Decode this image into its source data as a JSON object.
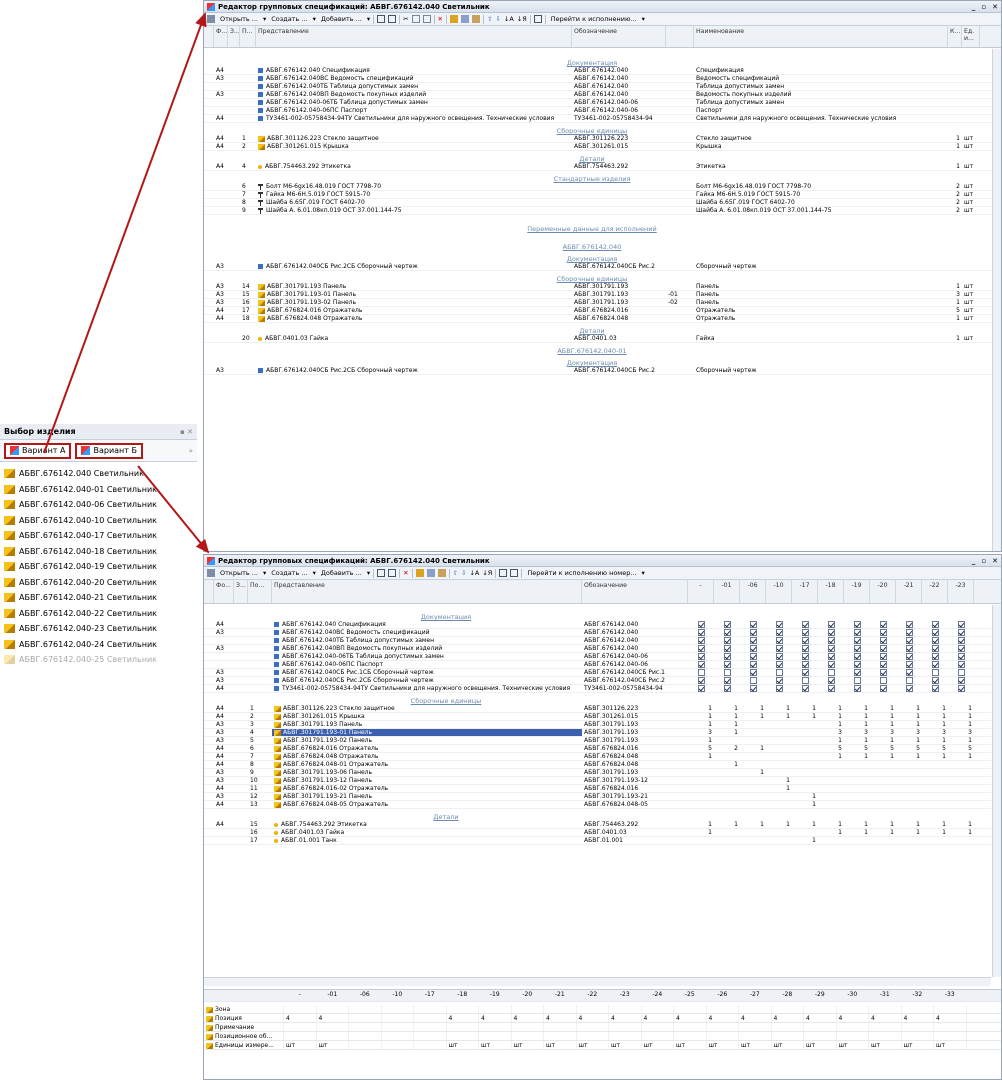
{
  "top_window": {
    "title": "Редактор групповых спецификаций: АБВГ.676142.040 Светильник",
    "toolbar": [
      "Открыть ...",
      "Создать ...",
      "Добавить ...",
      "Перейти к исполнению..."
    ],
    "headers": [
      "Ф...",
      "З...",
      "П...",
      "Представление",
      "Обозначение",
      "Наименование",
      "К...",
      "Ед. и..."
    ],
    "sections": {
      "docs": "Документация",
      "asm": "Сборочные единицы",
      "det": "Детали",
      "std": "Стандартные изделия",
      "vars": "Переменные данные для исполнений",
      "v1": "АБВГ.676142.040",
      "docs2": "Документация",
      "asm2": "Сборочные единицы",
      "det2": "Детали",
      "v2": "АБВГ.676142.040-01",
      "docs3": "Документация"
    },
    "rows_docs": [
      {
        "f": "А4",
        "p": "",
        "ico": "doc",
        "rep": "АБВГ.676142.040 Спецификация",
        "des": "АБВГ.676142.040",
        "name": "Спецификация",
        "k": "",
        "u": ""
      },
      {
        "f": "А3",
        "p": "",
        "ico": "doc",
        "rep": "АБВГ.676142.040ВС Ведомость спецификаций",
        "des": "АБВГ.676142.040",
        "name": "Ведомость спецификаций",
        "k": "",
        "u": ""
      },
      {
        "f": "",
        "p": "",
        "ico": "doc",
        "rep": "АБВГ.676142.040ТБ Таблица допустимых замен",
        "des": "АБВГ.676142.040",
        "name": "Таблица допустимых замен",
        "k": "",
        "u": ""
      },
      {
        "f": "А3",
        "p": "",
        "ico": "doc",
        "rep": "АБВГ.676142.040ВП Ведомость покупных изделий",
        "des": "АБВГ.676142.040",
        "name": "Ведомость покупных изделий",
        "k": "",
        "u": ""
      },
      {
        "f": "",
        "p": "",
        "ico": "doc",
        "rep": "АБВГ.676142.040-06ТБ Таблица допустимых замен",
        "des": "АБВГ.676142.040-06",
        "name": "Таблица допустимых замен",
        "k": "",
        "u": ""
      },
      {
        "f": "",
        "p": "",
        "ico": "doc",
        "rep": "АБВГ.676142.040-06ПС Паспорт",
        "des": "АБВГ.676142.040-06",
        "name": "Паспорт",
        "k": "",
        "u": ""
      },
      {
        "f": "А4",
        "p": "",
        "ico": "doc",
        "rep": "ТУ3461-002-05758434-94ТУ Светильники для наружного освещения. Технические условия",
        "des": "ТУ3461-002-05758434-94",
        "name": "Светильники для наружного освещения. Технические условия",
        "k": "",
        "u": ""
      }
    ],
    "rows_asm": [
      {
        "f": "А4",
        "p": "1",
        "ico": "asm",
        "rep": "АБВГ.301126.223 Стекло защитное",
        "des": "АБВГ.301126.223",
        "name": "Стекло защитное",
        "k": "1",
        "u": "шт"
      },
      {
        "f": "А4",
        "p": "2",
        "ico": "asm",
        "rep": "АБВГ.301261.015 Крышка",
        "des": "АБВГ.301261.015",
        "name": "Крышка",
        "k": "1",
        "u": "шт"
      }
    ],
    "rows_det": [
      {
        "f": "А4",
        "p": "4",
        "ico": "det",
        "rep": "АБВГ.754463.292 Этикетка",
        "des": "АБВГ.754463.292",
        "name": "Этикетка",
        "k": "1",
        "u": "шт"
      }
    ],
    "rows_std": [
      {
        "f": "",
        "p": "6",
        "ico": "std",
        "rep": "Болт М6-6gх16.48.019 ГОСТ 7798-70",
        "des": "",
        "name": "Болт М6-6gх16.48.019 ГОСТ 7798-70",
        "k": "2",
        "u": "шт"
      },
      {
        "f": "",
        "p": "7",
        "ico": "std",
        "rep": "Гайка М6-6Н.5.019 ГОСТ 5915-70",
        "des": "",
        "name": "Гайка М6-6Н.5.019 ГОСТ 5915-70",
        "k": "2",
        "u": "шт"
      },
      {
        "f": "",
        "p": "8",
        "ico": "std",
        "rep": "Шайба 6.65Г.019 ГОСТ 6402-70",
        "des": "",
        "name": "Шайба 6.65Г.019 ГОСТ 6402-70",
        "k": "2",
        "u": "шт"
      },
      {
        "f": "",
        "p": "9",
        "ico": "std",
        "rep": "Шайба А. 6.01.08кп.019 ОСТ 37.001.144-75",
        "des": "",
        "name": "Шайба А. 6.01.08кп.019 ОСТ 37.001.144-75",
        "k": "2",
        "u": "шт"
      }
    ],
    "rows_docs2": [
      {
        "f": "А3",
        "p": "",
        "ico": "doc",
        "rep": "АБВГ.676142.040СБ Рис.2СБ Сборочный чертеж",
        "des": "АБВГ.676142.040СБ Рис.2",
        "name": "Сборочный чертеж",
        "k": "",
        "u": ""
      }
    ],
    "rows_asm2": [
      {
        "f": "А3",
        "p": "14",
        "ico": "asm",
        "rep": "АБВГ.301791.193 Панель",
        "des": "АБВГ.301791.193",
        "x": "",
        "name": "Панель",
        "k": "1",
        "u": "шт"
      },
      {
        "f": "А3",
        "p": "15",
        "ico": "asm",
        "rep": "АБВГ.301791.193-01 Панель",
        "des": "АБВГ.301791.193",
        "x": "-01",
        "name": "Панель",
        "k": "3",
        "u": "шт"
      },
      {
        "f": "А3",
        "p": "16",
        "ico": "asm",
        "rep": "АБВГ.301791.193-02 Панель",
        "des": "АБВГ.301791.193",
        "x": "-02",
        "name": "Панель",
        "k": "1",
        "u": "шт"
      },
      {
        "f": "А4",
        "p": "17",
        "ico": "asm",
        "rep": "АБВГ.676824.016 Отражатель",
        "des": "АБВГ.676824.016",
        "x": "",
        "name": "Отражатель",
        "k": "5",
        "u": "шт"
      },
      {
        "f": "А4",
        "p": "18",
        "ico": "asm",
        "rep": "АБВГ.676824.048 Отражатель",
        "des": "АБВГ.676824.048",
        "x": "",
        "name": "Отражатель",
        "k": "1",
        "u": "шт"
      }
    ],
    "rows_det2": [
      {
        "f": "",
        "p": "20",
        "ico": "det",
        "rep": "АБВГ.0401.03 Гайка",
        "des": "АБВГ.0401.03",
        "name": "Гайка",
        "k": "1",
        "u": "шт"
      }
    ],
    "rows_docs3": [
      {
        "f": "А3",
        "p": "",
        "ico": "doc",
        "rep": "АБВГ.676142.040СБ Рис.2СБ Сборочный чертеж",
        "des": "АБВГ.676142.040СБ Рис.2",
        "name": "Сборочный чертеж",
        "k": "",
        "u": ""
      }
    ]
  },
  "left_panel": {
    "title": "Выбор изделия",
    "tabs": [
      "Вариант А",
      "Вариант Б"
    ],
    "items": [
      "АБВГ.676142.040 Светильник",
      "АБВГ.676142.040-01 Светильник",
      "АБВГ.676142.040-06 Светильник",
      "АБВГ.676142.040-10 Светильник",
      "АБВГ.676142.040-17 Светильник",
      "АБВГ.676142.040-18 Светильник",
      "АБВГ.676142.040-19 Светильник",
      "АБВГ.676142.040-20 Светильник",
      "АБВГ.676142.040-21 Светильник",
      "АБВГ.676142.040-22 Светильник",
      "АБВГ.676142.040-23 Светильник",
      "АБВГ.676142.040-24 Светильник",
      "АБВГ.676142.040-25 Светильник"
    ]
  },
  "bottom_window": {
    "title": "Редактор групповых спецификаций: АБВГ.676142.040 Светильник",
    "toolbar": [
      "Открыть ...",
      "Создать ...",
      "Добавить ...",
      "Перейти к исполнению номер..."
    ],
    "headers": [
      "Фо...",
      "З...",
      "По...",
      "Представление",
      "Обозначение"
    ],
    "var_cols": [
      "-",
      "-01",
      "-06",
      "-10",
      "-17",
      "-18",
      "-19",
      "-20",
      "-21",
      "-22",
      "-23"
    ],
    "sections": {
      "docs": "Документация",
      "asm": "Сборочные единицы",
      "det": "Детали"
    },
    "rows_docs": [
      {
        "f": "А4",
        "p": "",
        "rep": "АБВГ.676142.040 Спецификация",
        "des": "АБВГ.676142.040",
        "c": [
          1,
          1,
          1,
          1,
          1,
          1,
          1,
          1,
          1,
          1,
          1
        ]
      },
      {
        "f": "А3",
        "p": "",
        "rep": "АБВГ.676142.040ВС Ведомость спецификаций",
        "des": "АБВГ.676142.040",
        "c": [
          1,
          1,
          1,
          1,
          1,
          1,
          1,
          1,
          1,
          1,
          1
        ]
      },
      {
        "f": "",
        "p": "",
        "rep": "АБВГ.676142.040ТБ Таблица допустимых замен",
        "des": "АБВГ.676142.040",
        "c": [
          1,
          1,
          1,
          1,
          1,
          1,
          1,
          1,
          1,
          1,
          1
        ]
      },
      {
        "f": "А3",
        "p": "",
        "rep": "АБВГ.676142.040ВП Ведомость покупных изделий",
        "des": "АБВГ.676142.040",
        "c": [
          1,
          1,
          1,
          1,
          1,
          1,
          1,
          1,
          1,
          1,
          1
        ]
      },
      {
        "f": "",
        "p": "",
        "rep": "АБВГ.676142.040-06ТБ Таблица допустимых замен",
        "des": "АБВГ.676142.040-06",
        "c": [
          1,
          1,
          1,
          1,
          1,
          1,
          1,
          1,
          1,
          1,
          1
        ]
      },
      {
        "f": "",
        "p": "",
        "rep": "АБВГ.676142.040-06ПС Паспорт",
        "des": "АБВГ.676142.040-06",
        "c": [
          1,
          1,
          1,
          1,
          1,
          1,
          1,
          1,
          1,
          1,
          1
        ]
      },
      {
        "f": "А3",
        "p": "",
        "rep": "АБВГ.676142.040СБ Рис.1СБ Сборочный чертеж",
        "des": "АБВГ.676142.040СБ Рис.1",
        "c": [
          0,
          0,
          1,
          0,
          1,
          0,
          1,
          1,
          1,
          0,
          0
        ]
      },
      {
        "f": "А3",
        "p": "",
        "rep": "АБВГ.676142.040СБ Рис.2СБ Сборочный чертеж",
        "des": "АБВГ.676142.040СБ Рис.2",
        "c": [
          1,
          1,
          0,
          1,
          0,
          1,
          0,
          0,
          0,
          1,
          1
        ]
      },
      {
        "f": "А4",
        "p": "",
        "rep": "ТУ3461-002-05758434-94ТУ Светильники для наружного освещения. Технические условия",
        "des": "ТУ3461-002-05758434-94",
        "c": [
          1,
          1,
          1,
          1,
          1,
          1,
          1,
          1,
          1,
          1,
          1
        ]
      }
    ],
    "rows_asm": [
      {
        "f": "А4",
        "p": "1",
        "rep": "АБВГ.301126.223 Стекло защитное",
        "des": "АБВГ.301126.223",
        "v": [
          "1",
          "1",
          "1",
          "1",
          "1",
          "1",
          "1",
          "1",
          "1",
          "1",
          "1"
        ]
      },
      {
        "f": "А4",
        "p": "2",
        "rep": "АБВГ.301261.015 Крышка",
        "des": "АБВГ.301261.015",
        "v": [
          "1",
          "1",
          "1",
          "1",
          "1",
          "1",
          "1",
          "1",
          "1",
          "1",
          "1"
        ]
      },
      {
        "f": "А3",
        "p": "3",
        "rep": "АБВГ.301791.193 Панель",
        "des": "АБВГ.301791.193",
        "v": [
          "1",
          "1",
          "",
          "",
          "",
          "1",
          "1",
          "1",
          "1",
          "1",
          "1"
        ]
      },
      {
        "f": "А3",
        "p": "4",
        "rep": "АБВГ.301791.193-01 Панель",
        "des": "АБВГ.301791.193",
        "v": [
          "3",
          "1",
          "",
          "",
          "",
          "3",
          "3",
          "3",
          "3",
          "3",
          "3"
        ]
      },
      {
        "f": "А3",
        "p": "5",
        "rep": "АБВГ.301791.193-02 Панель",
        "des": "АБВГ.301791.193",
        "v": [
          "1",
          "",
          "",
          "",
          "",
          "1",
          "1",
          "1",
          "1",
          "1",
          "1"
        ]
      },
      {
        "f": "А4",
        "p": "6",
        "rep": "АБВГ.676824.016 Отражатель",
        "des": "АБВГ.676824.016",
        "v": [
          "5",
          "2",
          "1",
          "",
          "",
          "5",
          "5",
          "5",
          "5",
          "5",
          "5"
        ]
      },
      {
        "f": "А4",
        "p": "7",
        "rep": "АБВГ.676824.048 Отражатель",
        "des": "АБВГ.676824.048",
        "v": [
          "1",
          "",
          "",
          "",
          "",
          "1",
          "1",
          "1",
          "1",
          "1",
          "1"
        ]
      },
      {
        "f": "А4",
        "p": "8",
        "rep": "АБВГ.676824.048-01 Отражатель",
        "des": "АБВГ.676824.048",
        "v": [
          "",
          "1",
          "",
          "",
          "",
          "",
          "",
          "",
          "",
          "",
          ""
        ]
      },
      {
        "f": "А3",
        "p": "9",
        "rep": "АБВГ.301791.193-06 Панель",
        "des": "АБВГ.301791.193",
        "v": [
          "",
          "",
          "1",
          "",
          "",
          "",
          "",
          "",
          "",
          "",
          ""
        ]
      },
      {
        "f": "А3",
        "p": "10",
        "rep": "АБВГ.301791.193-12 Панель",
        "des": "АБВГ.301791.193-12",
        "v": [
          "",
          "",
          "",
          "1",
          "",
          "",
          "",
          "",
          "",
          "",
          ""
        ]
      },
      {
        "f": "А4",
        "p": "11",
        "rep": "АБВГ.676824.016-02 Отражатель",
        "des": "АБВГ.676824.016",
        "v": [
          "",
          "",
          "",
          "1",
          "",
          "",
          "",
          "",
          "",
          "",
          ""
        ]
      },
      {
        "f": "А3",
        "p": "12",
        "rep": "АБВГ.301791.193-21 Панель",
        "des": "АБВГ.301791.193-21",
        "v": [
          "",
          "",
          "",
          "",
          "1",
          "",
          "",
          "",
          "",
          "",
          ""
        ]
      },
      {
        "f": "А4",
        "p": "13",
        "rep": "АБВГ.676824.048-05 Отражатель",
        "des": "АБВГ.676824.048-05",
        "v": [
          "",
          "",
          "",
          "",
          "1",
          "",
          "",
          "",
          "",
          "",
          ""
        ]
      }
    ],
    "rows_det": [
      {
        "f": "А4",
        "p": "15",
        "rep": "АБВГ.754463.292 Этикетка",
        "des": "АБВГ.754463.292",
        "v": [
          "1",
          "1",
          "1",
          "1",
          "1",
          "1",
          "1",
          "1",
          "1",
          "1",
          "1"
        ]
      },
      {
        "f": "",
        "p": "16",
        "rep": "АБВГ.0401.03 Гайка",
        "des": "АБВГ.0401.03",
        "v": [
          "1",
          "",
          "",
          "",
          "",
          "1",
          "1",
          "1",
          "1",
          "1",
          "1"
        ]
      },
      {
        "f": "",
        "p": "17",
        "rep": "АБВГ.01.001 Танк",
        "des": "АБВГ.01.001",
        "v": [
          "",
          "",
          "",
          "",
          "1",
          "",
          "",
          "",
          "",
          "",
          ""
        ]
      }
    ],
    "bottom_cols": [
      "-",
      "-01",
      "-06",
      "-10",
      "-17",
      "-18",
      "-19",
      "-20",
      "-21",
      "-22",
      "-23",
      "-24",
      "-25",
      "-26",
      "-27",
      "-28",
      "-29",
      "-30",
      "-31",
      "-32",
      "-33"
    ],
    "bottom_rows": [
      {
        "label": "Зона",
        "v": []
      },
      {
        "label": "Позиция",
        "v": [
          "4",
          "4",
          "",
          "",
          "",
          "4",
          "4",
          "4",
          "4",
          "4",
          "4",
          "4",
          "4",
          "4",
          "4",
          "4",
          "4",
          "4",
          "4",
          "4",
          "4"
        ]
      },
      {
        "label": "Примечание",
        "v": []
      },
      {
        "label": "Позиционное об...",
        "v": []
      },
      {
        "label": "Единицы измере...",
        "v": [
          "шт",
          "шт",
          "",
          "",
          "",
          "шт",
          "шт",
          "шт",
          "шт",
          "шт",
          "шт",
          "шт",
          "шт",
          "шт",
          "шт",
          "шт",
          "шт",
          "шт",
          "шт",
          "шт",
          "шт"
        ]
      }
    ]
  },
  "colors": {
    "arrow": "#b21818",
    "selected": "#3b5fad",
    "section": "#6b8ab0"
  }
}
